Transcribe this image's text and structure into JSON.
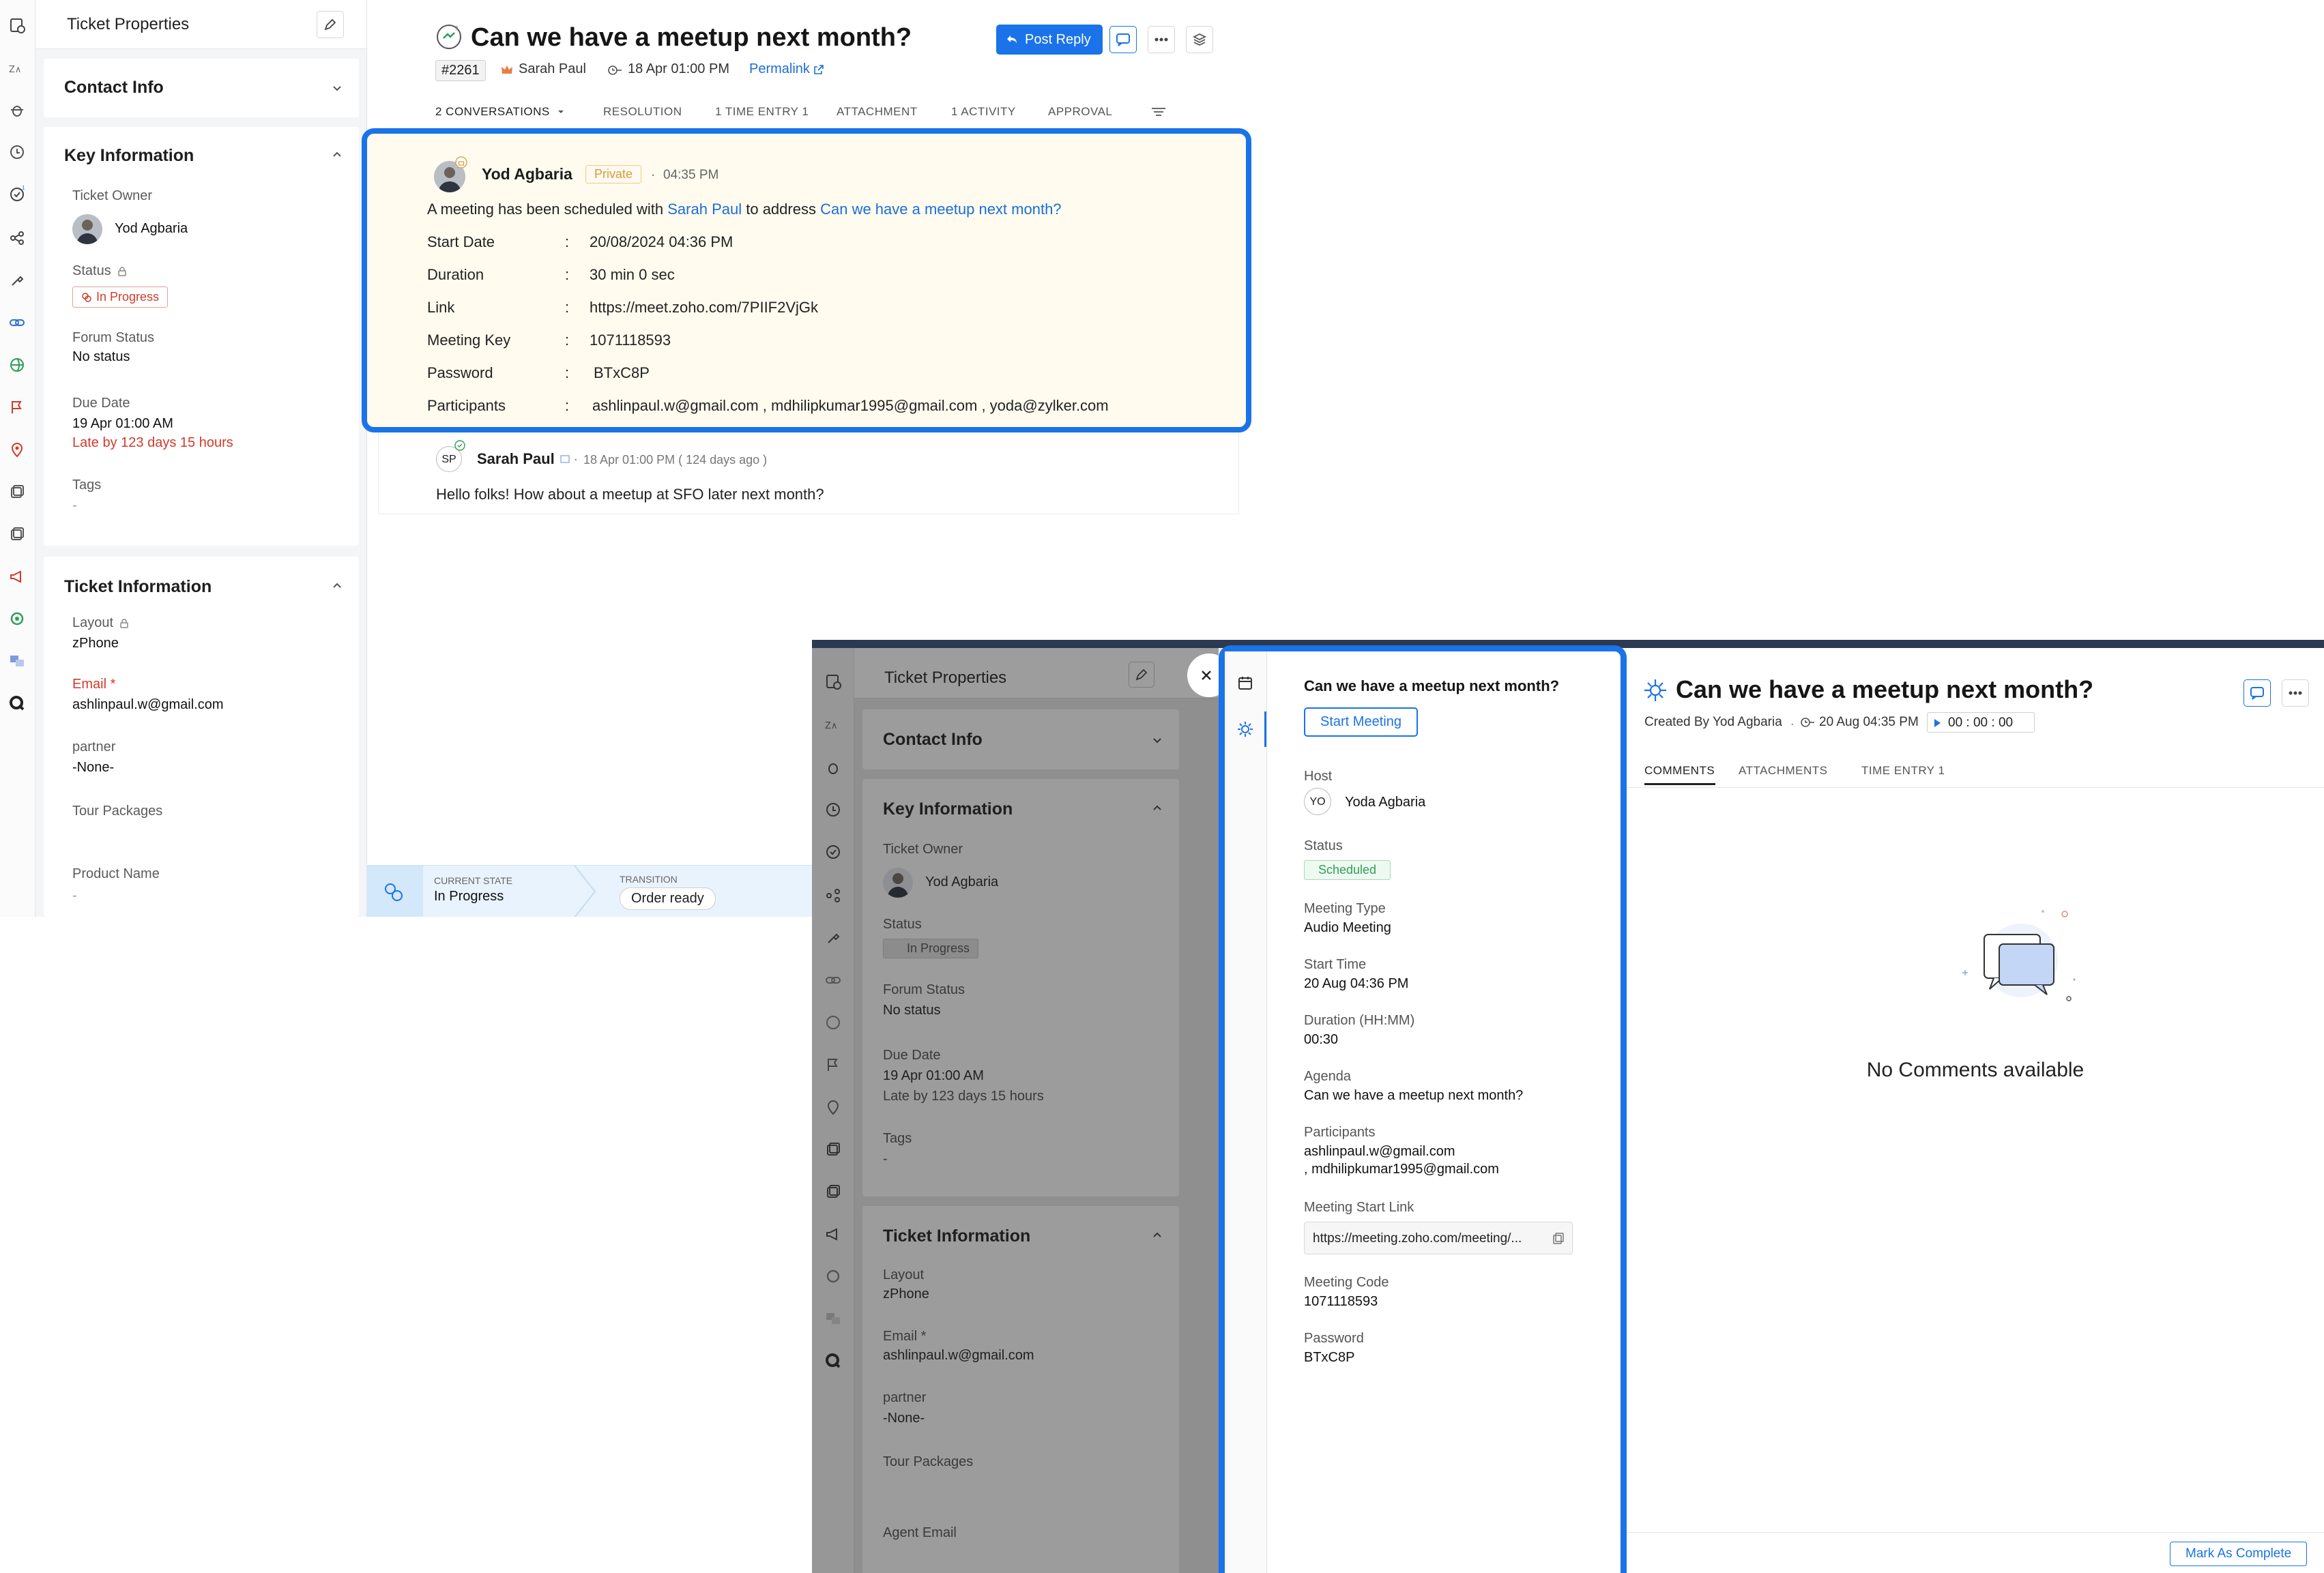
{
  "background": {
    "properties": {
      "title": "Ticket Properties",
      "contact_info": "Contact Info",
      "key_information": "Key Information",
      "ticket_owner_label": "Ticket Owner",
      "ticket_owner": "Yod Agbaria",
      "status_label": "Status",
      "status_value": "In Progress",
      "forum_status_label": "Forum Status",
      "forum_status": "No status",
      "due_date_label": "Due Date",
      "due_date": "19 Apr 01:00 AM",
      "late_by": "Late by 123 days 15 hours",
      "tags_label": "Tags",
      "tags_value": "-",
      "ticket_information": "Ticket Information",
      "layout_label": "Layout",
      "layout_value": "zPhone",
      "email_label": "Email *",
      "email_value": "ashlinpaul.w@gmail.com",
      "partner_label": "partner",
      "partner_value": "-None-",
      "tour_packages_label": "Tour Packages",
      "product_name_label": "Product Name",
      "product_name_value": "-"
    },
    "ticket": {
      "title": "Can we have a meetup next month?",
      "number": "#2261",
      "author": "Sarah Paul",
      "date": "18 Apr 01:00 PM",
      "permalink": "Permalink",
      "post_reply": "Post Reply",
      "tabs": [
        "2 CONVERSATIONS",
        "RESOLUTION",
        "1 TIME ENTRY 1",
        "ATTACHMENT",
        "1 ACTIVITY",
        "APPROVAL"
      ]
    },
    "meeting_conversation": {
      "author": "Yod Agbaria",
      "private_label": "Private",
      "time": "04:35 PM",
      "intro_prefix": "A meeting has been scheduled with",
      "intro_person": "Sarah Paul",
      "intro_mid": "to address",
      "intro_topic": "Can we have a meetup next month?",
      "rows": [
        {
          "label": "Start Date",
          "value": "20/08/2024 04:36 PM"
        },
        {
          "label": "Duration",
          "value": "30 min 0 sec"
        },
        {
          "label": "Link",
          "value": "https://meet.zoho.com/7PIIF2VjGk"
        },
        {
          "label": "Meeting Key",
          "value": "1071118593"
        },
        {
          "label": "Password",
          "value": "BTxC8P"
        },
        {
          "label": "Participants",
          "value": "ashlinpaul.w@gmail.com , mdhilipkumar1995@gmail.com , yoda@zylker.com"
        }
      ],
      "separator": ":"
    },
    "reply": {
      "initials": "SP",
      "author": "Sarah Paul",
      "meta": "18 Apr 01:00 PM ( 124 days ago )",
      "body": "Hello folks! How about a meetup at SFO later next month?"
    },
    "state_bar": {
      "current_state_label": "CURRENT STATE",
      "current_state": "In Progress",
      "transition_label": "TRANSITION",
      "transition": "Order ready"
    }
  },
  "overlay": {
    "dimmed_props": {
      "title": "Ticket Properties",
      "contact_info": "Contact Info",
      "key_information": "Key Information",
      "ticket_owner_label": "Ticket Owner",
      "ticket_owner": "Yod Agbaria",
      "status_label": "Status",
      "status_value": "In Progress",
      "forum_status_label": "Forum Status",
      "forum_status": "No status",
      "due_date_label": "Due Date",
      "due_date": "19 Apr 01:00 AM",
      "late_by": "Late by 123 days 15 hours",
      "tags_label": "Tags",
      "tags_value": "-",
      "ticket_information": "Ticket Information",
      "layout_label": "Layout",
      "layout_value": "zPhone",
      "email_label": "Email *",
      "email_value": "ashlinpaul.w@gmail.com",
      "partner_label": "partner",
      "partner_value": "-None-",
      "tour_packages_label": "Tour Packages",
      "agent_email_label": "Agent Email"
    },
    "meeting_panel": {
      "title": "Can we have a meetup next month?",
      "start_meeting": "Start Meeting",
      "host_label": "Host",
      "host_initials": "YO",
      "host_name": "Yoda Agbaria",
      "status_label": "Status",
      "status_value": "Scheduled",
      "meeting_type_label": "Meeting Type",
      "meeting_type": "Audio Meeting",
      "start_time_label": "Start Time",
      "start_time": "20 Aug 04:36 PM",
      "duration_label": "Duration (HH:MM)",
      "duration": "00:30",
      "agenda_label": "Agenda",
      "agenda": "Can we have a meetup next month?",
      "participants_label": "Participants",
      "participants_line1": "ashlinpaul.w@gmail.com",
      "participants_line2": ", mdhilipkumar1995@gmail.com",
      "start_link_label": "Meeting Start Link",
      "start_link": "https://meeting.zoho.com/meeting/...",
      "meeting_code_label": "Meeting Code",
      "meeting_code": "1071118593",
      "password_label": "Password",
      "password": "BTxC8P"
    },
    "activity": {
      "title": "Can we have a meetup next month?",
      "created_by": "Created By Yod Agbaria",
      "date": "20 Aug 04:35 PM",
      "timer": "00 : 00 : 00",
      "tabs": [
        "COMMENTS",
        "ATTACHMENTS",
        "TIME ENTRY 1"
      ],
      "empty_text": "No Comments available",
      "mark_complete": "Mark As Complete"
    }
  },
  "colors": {
    "accent": "#1a73e8",
    "danger": "#d23a2a",
    "private": "#d59b3e",
    "scheduled": "#2f9e5a",
    "meeting_card_bg": "#fffbef"
  }
}
